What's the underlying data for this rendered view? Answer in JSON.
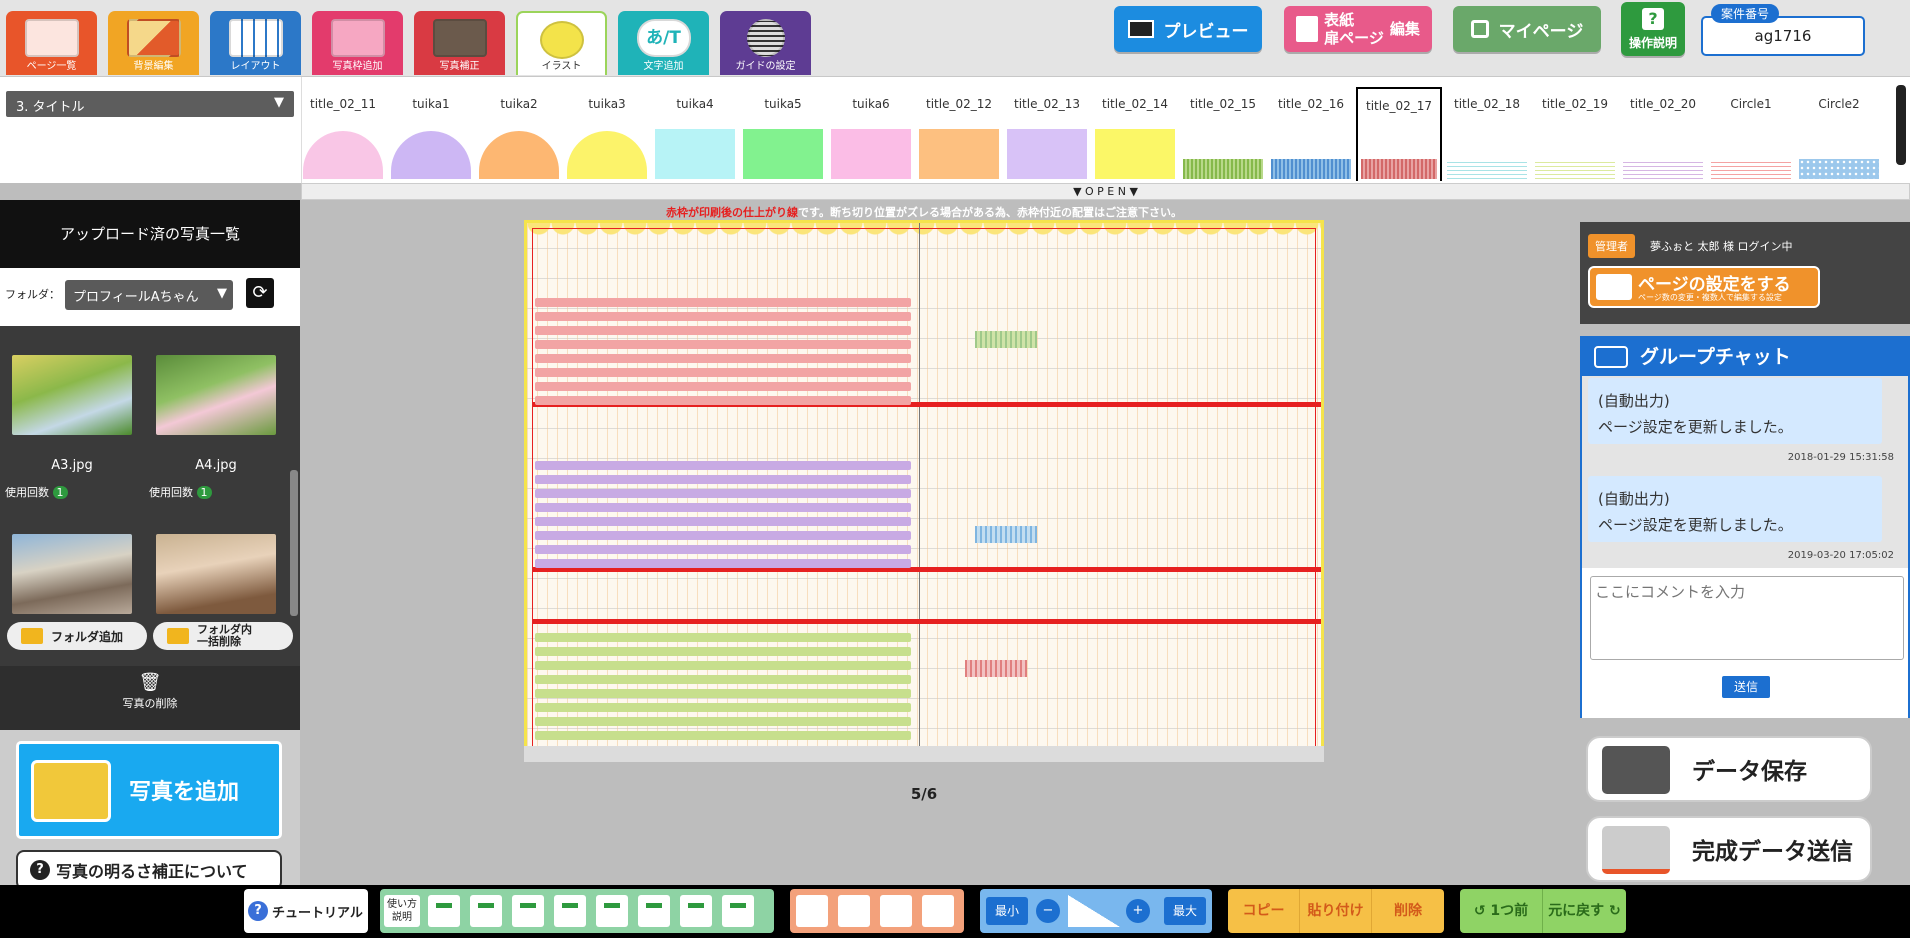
{
  "top_tabs": [
    {
      "label": "ページ一覧",
      "icon": "page-list-icon",
      "color": "#e8552a"
    },
    {
      "label": "背景編集",
      "icon": "background-icon",
      "color": "#f1a524"
    },
    {
      "label": "レイアウト",
      "icon": "layout-icon",
      "color": "#2c78c8"
    },
    {
      "label": "写真枠追加",
      "icon": "photo-frame-icon",
      "color": "#e33b6c"
    },
    {
      "label": "写真補正",
      "icon": "photo-fix-icon",
      "color": "#d93a43"
    },
    {
      "label": "イラスト",
      "icon": "illustration-icon",
      "color": "#ffffff"
    },
    {
      "label": "文字追加",
      "icon": "text-add-icon",
      "color": "#1fb3b8"
    },
    {
      "label": "ガイドの設定",
      "icon": "guide-icon",
      "color": "#5e3c93"
    }
  ],
  "header": {
    "preview_label": "プレビュー",
    "cover_label_1": "表紙",
    "cover_label_2": "扉ページ",
    "cover_edit": "編集",
    "mypage_label": "マイページ",
    "help_label": "操作説明",
    "case_label": "案件番号",
    "case_value": "ag1716"
  },
  "category_select": "3. タイトル",
  "illustrations": [
    {
      "name": "title_02_11",
      "color": "#f9c6e6",
      "shape": "semi"
    },
    {
      "name": "tuika1",
      "color": "#cdb7f4",
      "shape": "semi"
    },
    {
      "name": "tuika2",
      "color": "#fdb772",
      "shape": "semi"
    },
    {
      "name": "tuika3",
      "color": "#fcf36a",
      "shape": "semi"
    },
    {
      "name": "tuika4",
      "color": "#b7f3f6",
      "shape": "rect"
    },
    {
      "name": "tuika5",
      "color": "#82f28f",
      "shape": "rect"
    },
    {
      "name": "tuika6",
      "color": "#fbbde6",
      "shape": "rect"
    },
    {
      "name": "title_02_12",
      "color": "#fdc080",
      "shape": "rect"
    },
    {
      "name": "title_02_13",
      "color": "#d8c2f7",
      "shape": "rect"
    },
    {
      "name": "title_02_14",
      "color": "#fbf767",
      "shape": "rect"
    },
    {
      "name": "title_02_15",
      "color": "#b8d98a",
      "shape": "check"
    },
    {
      "name": "title_02_16",
      "color": "#8fbfe6",
      "shape": "check"
    },
    {
      "name": "title_02_17",
      "color": "#e8a3a3",
      "shape": "check"
    },
    {
      "name": "title_02_18",
      "color": "#a9e3e6",
      "shape": "line"
    },
    {
      "name": "title_02_19",
      "color": "#dcea9e",
      "shape": "line"
    },
    {
      "name": "title_02_20",
      "color": "#d6b6e3",
      "shape": "line"
    },
    {
      "name": "Circle1",
      "color": "#f4a3a3",
      "shape": "line"
    },
    {
      "name": "Circle2",
      "color": "#9cc8ec",
      "shape": "dots"
    }
  ],
  "open_label": "▼ O P E N ▼",
  "notice": {
    "red": "赤枠が印刷後の仕上がり線",
    "rest": "です。断ち切り位置がズレる場合がある為、赤枠付近の配置はご注意下さい。"
  },
  "left": {
    "title": "アップロード済の写真一覧",
    "folder_label": "フォルダ：",
    "folder_value": "プロフィールAちゃん",
    "photos": [
      {
        "name": "A3.jpg",
        "usage_label": "使用回数",
        "usage": "1"
      },
      {
        "name": "A4.jpg",
        "usage_label": "使用回数",
        "usage": "1"
      }
    ],
    "add_folder": "フォルダ追加",
    "delete_in_folder": "フォルダ内\n一括削除",
    "photo_delete": "写真の削除",
    "add_photo": "写真を追加",
    "brightness": "写真の明るさ補正について"
  },
  "page_indicator": "5/6",
  "right": {
    "role": "管理者",
    "login": "夢ふぉと 太郎 様 ログイン中",
    "page_settings": "ページの設定をする",
    "page_settings_sub": "ページ数の変更・複数人で編集する設定",
    "chat_title": "グループチャット",
    "messages": [
      {
        "line1": "(自動出力)",
        "line2": "ページ設定を更新しました。",
        "time": "2018-01-29 15:31:58"
      },
      {
        "line1": "(自動出力)",
        "line2": "ページ設定を更新しました。",
        "time": "2019-03-20 17:05:02"
      }
    ],
    "comment_placeholder": "ここにコメントを入力",
    "send": "送信",
    "save_data": "データ保存",
    "send_final": "完成データ送信"
  },
  "bottom": {
    "tutorial": "チュートリアル",
    "howto": "使い方説明",
    "zoom_min": "最小",
    "zoom_max": "最大",
    "copy": "コピー",
    "paste": "貼り付け",
    "delete": "削除",
    "undo": "1つ前",
    "redo": "元に戻す"
  }
}
